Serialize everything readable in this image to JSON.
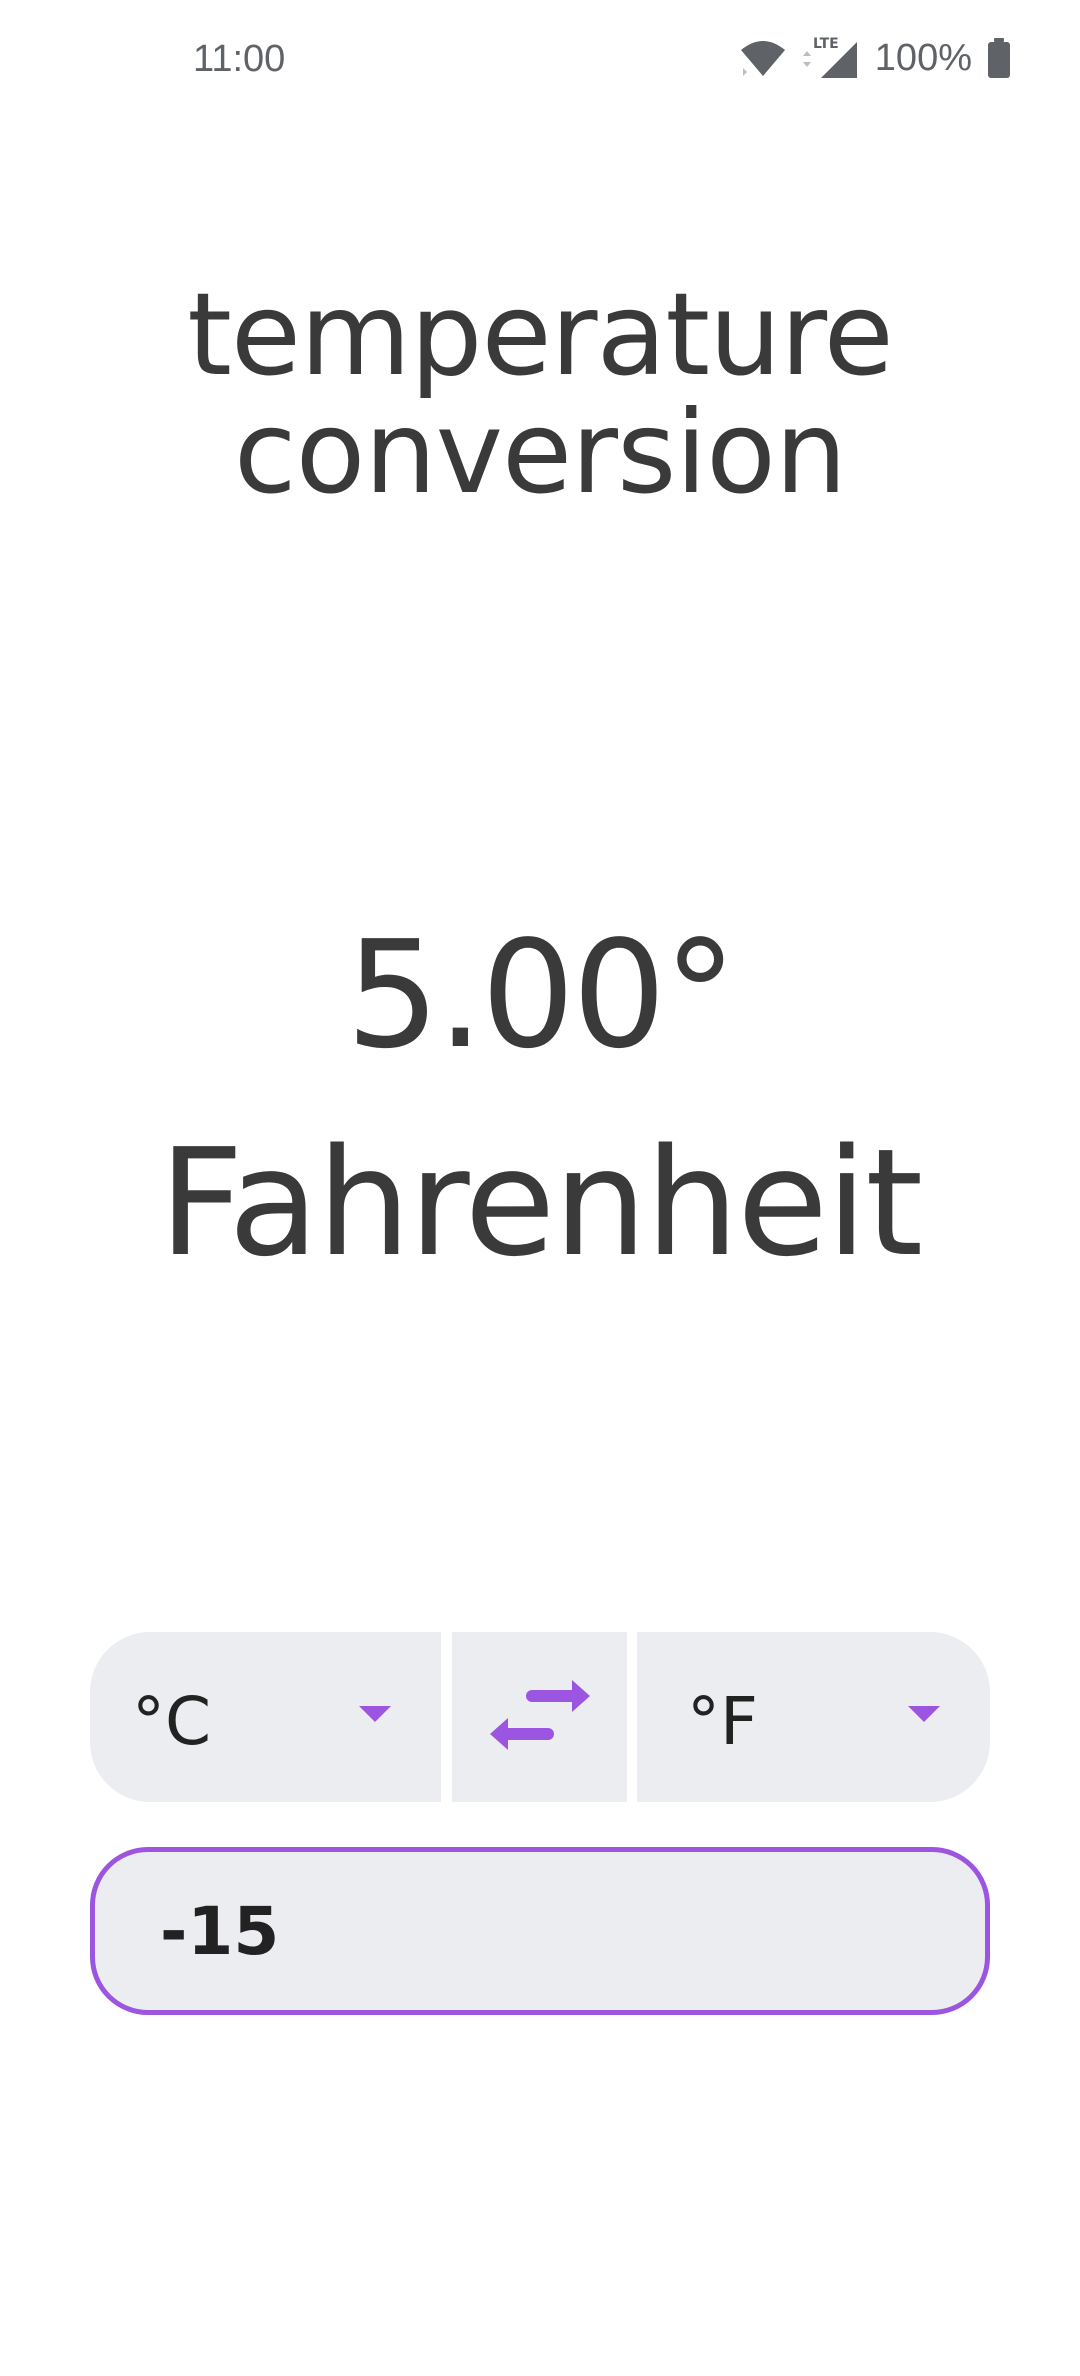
{
  "status_bar": {
    "time": "11:00",
    "battery_percent": "100%",
    "network_label": "LTE",
    "icons": [
      "wifi-icon",
      "lte-signal-icon",
      "battery-icon"
    ]
  },
  "app": {
    "title_line1": "temperature",
    "title_line2": "conversion"
  },
  "result": {
    "value": "5.00°",
    "unit": "Fahrenheit"
  },
  "converter": {
    "from_unit": "°C",
    "to_unit": "°F",
    "swap_icon": "swap-arrows-icon",
    "input_value": "-15",
    "accent_color": "#9b55e0"
  }
}
